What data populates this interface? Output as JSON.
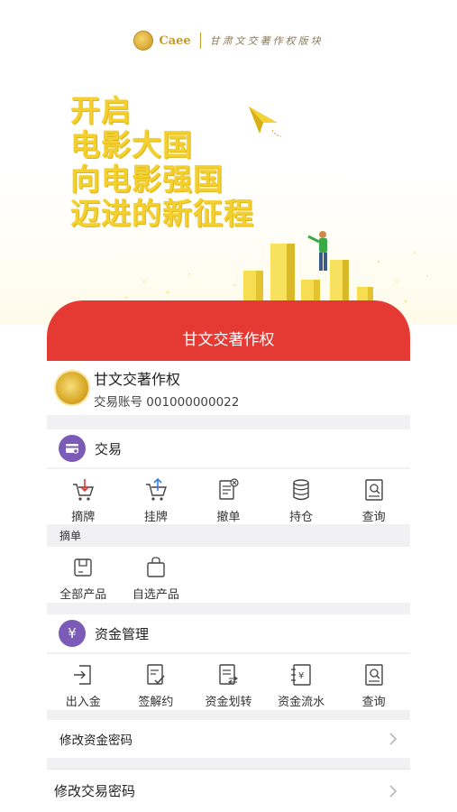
{
  "brand": {
    "word": "Caee",
    "slogan": "甘肃文交著作权版块"
  },
  "headline": [
    "开启",
    "电影大国",
    "向电影强国",
    "迈进的新征程"
  ],
  "titlebar": {
    "title": "甘文交著作权"
  },
  "account": {
    "name": "甘文交著作权",
    "number_label": "交易账号 001000000022"
  },
  "trade": {
    "title": "交易",
    "badge_icon": "card-icon",
    "items": [
      {
        "label": "摘牌",
        "icon": "cart-down-icon"
      },
      {
        "label": "挂牌",
        "icon": "cart-up-icon"
      },
      {
        "label": "撤单",
        "icon": "revoke-doc-icon"
      },
      {
        "label": "持仓",
        "icon": "database-icon"
      },
      {
        "label": "查询",
        "icon": "search-doc-icon"
      }
    ],
    "sub_label": "摘单",
    "sub_items": [
      {
        "label": "全部产品",
        "icon": "box-icon"
      },
      {
        "label": "自选产品",
        "icon": "bag-icon"
      }
    ]
  },
  "funds": {
    "title": "资金管理",
    "badge_icon": "yen-icon",
    "badge_text": "¥",
    "items": [
      {
        "label": "出入金",
        "icon": "in-out-icon"
      },
      {
        "label": "签解约",
        "icon": "sign-doc-icon"
      },
      {
        "label": "资金划转",
        "icon": "transfer-doc-icon"
      },
      {
        "label": "资金流水",
        "icon": "ledger-icon"
      },
      {
        "label": "查询",
        "icon": "search-doc-icon"
      }
    ]
  },
  "rows": {
    "change_fund_password": "修改资金密码",
    "change_trade_password": "修改交易密码"
  },
  "colors": {
    "header_red": "#e43a33",
    "badge_purple": "#7b5bb7",
    "headline_gold": "#f3cf2f"
  }
}
